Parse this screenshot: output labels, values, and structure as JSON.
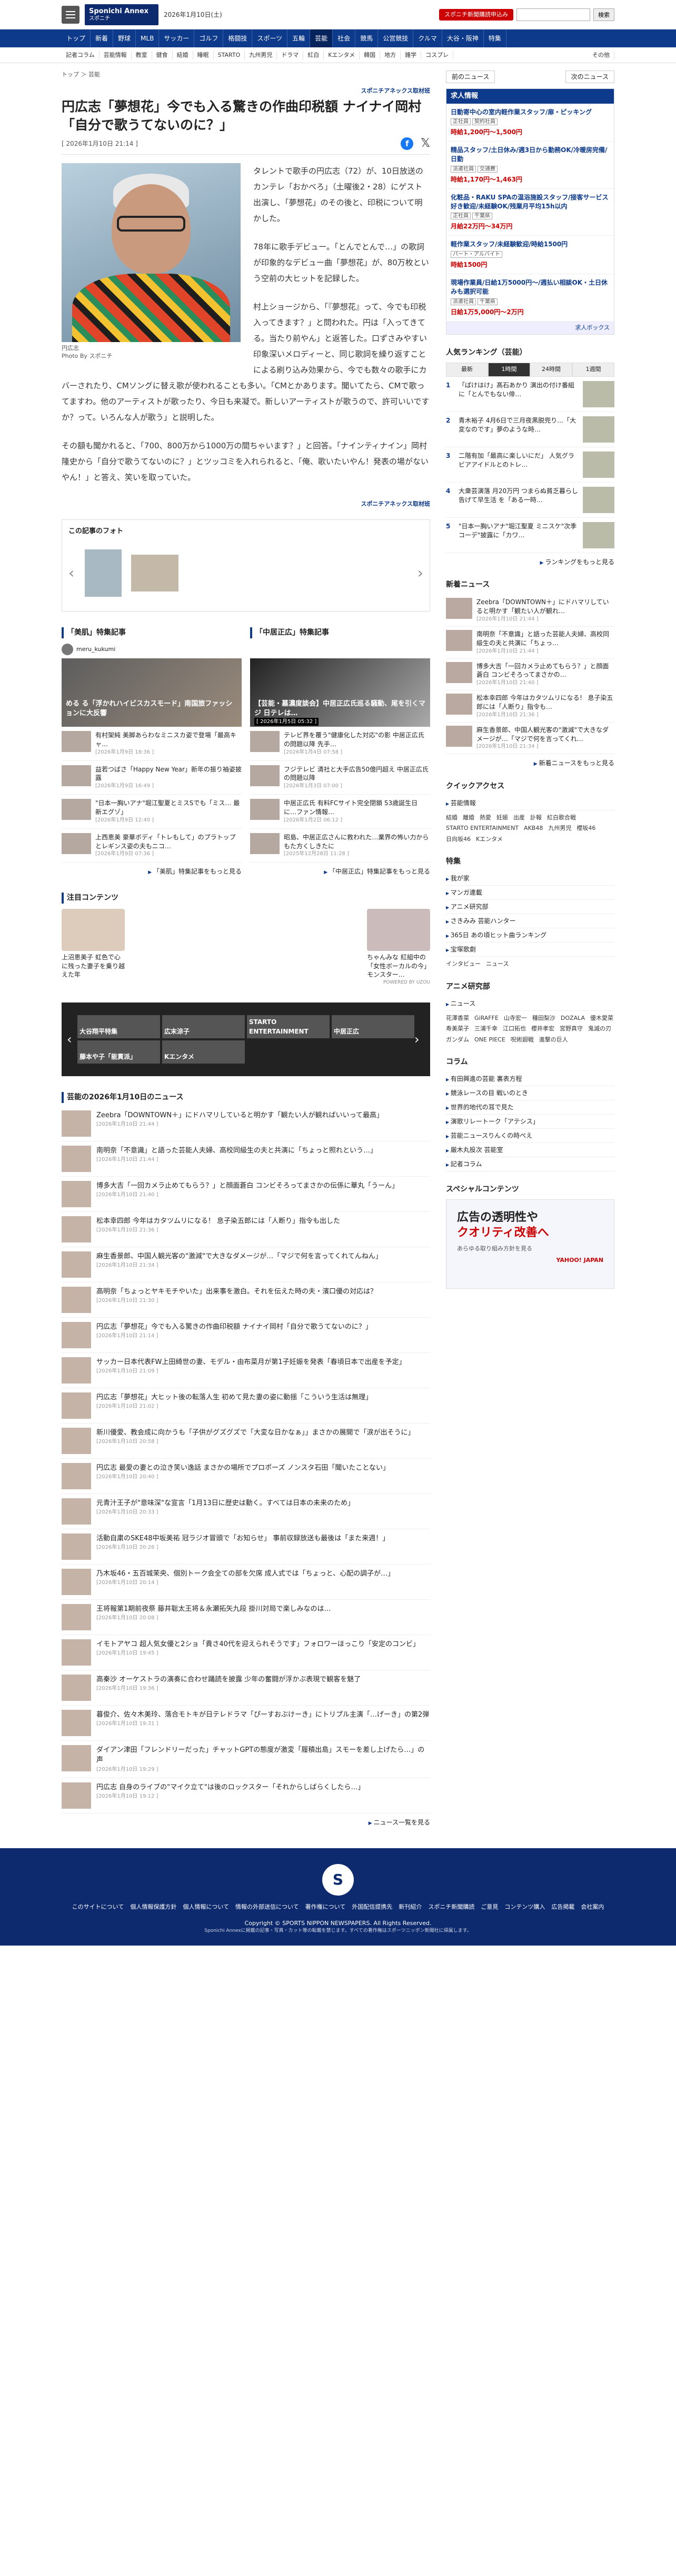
{
  "header": {
    "logo_title": "Sponichi Annex",
    "logo_sub": "スポニチ",
    "date": "2026年1月10日(土)",
    "promo": "スポニチ新聞購読申込み",
    "search_placeholder": "",
    "search_button": "検索"
  },
  "nav": [
    "トップ",
    "新着",
    "野球",
    "MLB",
    "サッカー",
    "ゴルフ",
    "格闘技",
    "スポーツ",
    "五輪",
    "芸能",
    "社会",
    "競馬",
    "公営競技",
    "クルマ",
    "大谷・阪神",
    "特集"
  ],
  "subnav": [
    "記者コラム",
    "芸能情報",
    "教室",
    "健食",
    "結婚",
    "睡眠",
    "STARTO",
    "九州男児",
    "ドラマ",
    "紅白",
    "Kエンタメ",
    "韓国",
    "地方",
    "雑学",
    "コスプレ",
    "その他"
  ],
  "breadcrumb": "トップ ＞ 芸能",
  "article": {
    "source": "スポニチアネックス取材班",
    "title": "円広志「夢想花」今でも入る驚きの作曲印税額 ナイナイ岡村「自分で歌うてないのに？」",
    "date": "[ 2026年1月10日 21:14 ]",
    "caption": "円広志",
    "credit": "Photo By スポニチ",
    "p1": "タレントで歌手の円広志（72）が、10日放送のカンテレ「おかべろ」（土曜後2・28）にゲスト出演し、「夢想花」のその後と、印税について明かした。",
    "p2": "78年に歌手デビュー。「とんでとんで…」の歌詞が印象的なデビュー曲「夢想花」が、80万枚という空前の大ヒットを記録した。",
    "p3": "村上ショージから、「『夢想花』って、今でも印税入ってきます？」と問われた。円は「入ってきてる。当たり前やん」と返答した。口ずさみやすい印象深いメロディーと、同じ歌詞を繰り返すことによる刷り込み効果から、今でも数々の歌手にカバーされたり、CMソングに替え歌が使われることも多い。「CMとかあります。聞いてたら、CMで歌ってますわ。他のアーティストが歌ったり、今日も来凝で。新しいアーティストが歌うので、許可いいですか？って。いろんな人が歌う」と説明した。",
    "p4": "その額も聞かれると、「700、800万から1000万の間ちゃいます？」と回答。「ナインティナイン」岡村隆史から「自分で歌うてないのに？」とツッコミを入れられると、「俺、歌いたいやん！発表の場がないやん！」と答え、笑いを取っていた。",
    "source2": "スポニチアネックス取材班"
  },
  "photos_box": {
    "title": "この記事のフォト"
  },
  "features": [
    {
      "title": "「美肌」特集記事",
      "user": "meru_kukumi",
      "hero": "める る「浮かれハイビスカスモード」南国旅ファッションに大反響",
      "hero_date": "",
      "items": [
        {
          "t": "有村架純 美脚あらわなミニスカ姿で登場「最高キャ…",
          "d": "[2026年1月9日 18:36 ]"
        },
        {
          "t": "益若つばさ「Happy New Year」新年の振り袖姿披露",
          "d": "[2026年1月9日 16:49 ]"
        },
        {
          "t": "\"日本一胸いアナ\"堀江聖夏とミスSでも「ミス… 最新エグゾ」",
          "d": "[2026年1月9日 12:40 ]"
        },
        {
          "t": "上西恵美 豪華ボディ「トレもして」のプラトップとレギンス姿の夫もニコ…",
          "d": "[2026年1月9日 07:36 ]"
        }
      ]
    },
    {
      "title": "「中居正広」特集記事",
      "user": "",
      "hero": "【芸能・墓濃度談会】中居正広氏巡る騒動、尾を引くマジ 日テレは…",
      "hero_date": "[ 2026年1月5日 05:32 ]",
      "items": [
        {
          "t": "テレビ界を覆う\"健康化した対応\"の影 中居正広氏の問題以降 先手…",
          "d": "[2026年1月4日 07:58 ]"
        },
        {
          "t": "フジテレビ 清社と大手広告50億円超え 中居正広氏の問題以降",
          "d": "[2026年1月3日 07:00 ]"
        },
        {
          "t": "中居正広氏 有料FCサイト完全閉鎖 53歳誕生日に…ファン情報…",
          "d": "[2026年1月2日 06:12 ]"
        },
        {
          "t": "昭島、中居正広さんに救われた…業界の怖い力からもた方くしきたに",
          "d": "[2025年12月28日 11:28 ]"
        }
      ]
    }
  ],
  "features_more": [
    "「美肌」特集記事をもっと見る",
    "「中居正広」特集記事をもっと見る"
  ],
  "attention": {
    "title": "注目コンテンツ",
    "items": [
      {
        "t": "上沼恵美子 虹色で心に残った妻子を乗り越えた年"
      },
      {
        "t": "ちゃんみな 紅組中の「女性ボーカルの今」モンスター…"
      }
    ],
    "brand": "POWERED BY UZOU"
  },
  "banners": [
    "大谷翔平特集",
    "広末涼子",
    "STARTO ENTERTAINMENT",
    "中居正広",
    "藤本や子「能貫派」",
    "Kエンタメ"
  ],
  "news": {
    "title": "芸能の2026年1月10日のニュース",
    "more": "ニュース一覧を見る",
    "items": [
      {
        "t": "Zeebra「DOWNTOWN＋」にドハマリしていると明かす「観たい人が観ればいいって最高」",
        "d": "[2026年1月10日 21:44 ]"
      },
      {
        "t": "南明奈「不意識」と語った芸能人夫婦、高校同級生の夫と共演に「ちょっと照れという…」",
        "d": "[2026年1月10日 21:44 ]"
      },
      {
        "t": "博多大吉「一回カメラ止めてもらう？」と顔面蒼白 コンビそろってまさかの伝係に華丸「うーん」",
        "d": "[2026年1月10日 21:40 ]"
      },
      {
        "t": "松本幸四郎 今年はカタツムリになる！ 息子染五郎には「人断り」指令も出した",
        "d": "[2026年1月10日 21:36 ]"
      },
      {
        "t": "麻生香景郎、中国人観光客の\"激減\"で大きなダメージが…「マジで何を言ってくれてんねん」",
        "d": "[2026年1月10日 21:34 ]"
      },
      {
        "t": "高明奈「ちょっとヤキモチやいた」出来事を激白。それを伝えた時の夫・濱口優の対応は？",
        "d": "[2026年1月10日 21:30 ]"
      },
      {
        "t": "円広志「夢想花」今でも入る驚きの作曲印税額 ナイナイ岡村「自分で歌うてないのに？」",
        "d": "[2026年1月10日 21:14 ]"
      },
      {
        "t": "サッカー日本代表FW上田綺世の妻、モデル・由布菜月が第1子妊娠を発表「春頃日本で出産を予定」",
        "d": "[2026年1月10日 21:09 ]"
      },
      {
        "t": "円広志「夢想花」大ヒット後の転落人生 初めて見た妻の姿に動揺「こういう生活は無理」",
        "d": "[2026年1月10日 21:02 ]"
      },
      {
        "t": "新川優愛、教会成に向かうも「子供がグズグズで「大変な日かなぁ」」まさかの展開で「涙が出そうに」",
        "d": "[2026年1月10日 20:58 ]"
      },
      {
        "t": "円広志 最愛の妻との泣き笑い逸話 まさかの場所でプロポーズ ノンスタ石田「聞いたことない」",
        "d": "[2026年1月10日 20:40 ]"
      },
      {
        "t": "元青汁王子が\"意味深\"な宣言「1月13日に歴史は動く。すべては日本の未来のため」",
        "d": "[2026年1月10日 20:33 ]"
      },
      {
        "t": "活動自粛のSKE48中坂美祐 冠ラジオ冒頭で「お知らせ」 事前収録放送も最後は「また来週！」",
        "d": "[2026年1月10日 20:26 ]"
      },
      {
        "t": "乃木坂46・五百城茉央、個別トーク会全ての部を欠席 成人式では「ちょっと、心配の調子が…」",
        "d": "[2026年1月10日 20:14 ]"
      },
      {
        "t": "王将報第1期前夜祭 藤井聡太王将＆永瀬拓矢九段 掛川対局で楽しみなのは…",
        "d": "[2026年1月10日 20:08 ]"
      },
      {
        "t": "イモトアヤコ 超人気女優と2ショ「貴さ40代を迎えられそうです」フォロワーほっこり「安定のコンビ」",
        "d": "[2026年1月10日 19:45 ]"
      },
      {
        "t": "高秦沙 オーケストラの演奏に合わせ踊読を披露 少年の奮闘が浮かぶ表現で観客を魅了",
        "d": "[2026年1月10日 19:36 ]"
      },
      {
        "t": "暮俊介、佐々木美玲、落合モトキが日テレドラマ「ぴーすおぶけーき」にトリプル主演「…げーき」の第2弾",
        "d": "[2026年1月10日 19:31 ]"
      },
      {
        "t": "ダイアン津田「フレンドリーだった」チャットGPTの態度が激変「履積出島」スモーを差し上げたら…」の声",
        "d": "[2026年1月10日 19:29 ]"
      },
      {
        "t": "円広志 自身のライブの\"マイク立て\"は後のロックスター「それからしばらくしたら…」",
        "d": "[2026年1月10日 19:12 ]"
      }
    ]
  },
  "right": {
    "prev": "前のニュース",
    "next": "次のニュース",
    "jobs": {
      "title": "求人情報",
      "footer": "求人ボックス",
      "items": [
        {
          "t": "日動寄中心の室内軽作業スタッフ/扉・ピッキング",
          "tags": [
            "正社員",
            "契約社員"
          ],
          "pay": "時給1,200円〜1,500円"
        },
        {
          "t": "精品スタッフ/土日休み/週3日から勤務OK/冷暖房完備/日勤",
          "tags": [
            "派遣社員",
            "交通費"
          ],
          "pay": "時給1,170円〜1,463円"
        },
        {
          "t": "化粧品・RAKU SPAの温浴施設スタッフ/接客サービス好き歓迎/未経験OK/残業月平均15h以内",
          "tags": [
            "正社員",
            "千葉県"
          ],
          "pay": "月給22万円〜34万円"
        },
        {
          "t": "軽作業スタッフ/未経験歓迎/時給1500円",
          "tags": [
            "パート・アルバイト"
          ],
          "pay": "時給1500円"
        },
        {
          "t": "現場作業員/日給1万5000円〜/週払い相談OK・土日休みも選択可能",
          "tags": [
            "派遣社員",
            "千葉県"
          ],
          "pay": "日給1万5,000円〜2万円"
        }
      ]
    },
    "ranking": {
      "title": "人気ランキング（芸能）",
      "tabs": [
        "最新",
        "1時間",
        "24時間",
        "1週間"
      ],
      "items": [
        {
          "n": "1",
          "t": "「ぱけはけ」髙石あかり 演出の付け番組に「とんでもない俳…"
        },
        {
          "n": "2",
          "t": "青木裕子 4月6日で三月夜黒脱兜り…「大変なのです」夢のような時…"
        },
        {
          "n": "3",
          "t": "二階有加「最高に楽しいにだ」 人気グラビアアイドルとのトレ…"
        },
        {
          "n": "4",
          "t": "大衆芸演落 月20万円 つまらぬ貧乏暮らし告げて早生活 を「ある一時…"
        },
        {
          "n": "5",
          "t": "\"日本一胸いアナ\"堀江聖夏 ミニスケ\"次季コーデ\"披露に「カワ…"
        }
      ],
      "more": "ランキングをもっと見る"
    },
    "latest": {
      "title": "新着ニュース",
      "more": "新着ニュースをもっと見る",
      "items": [
        {
          "t": "Zeebra「DOWNTOWN＋」にドハマリしていると明かす「観たい人が観れ…",
          "d": "[2026年1月10日 21:44 ]"
        },
        {
          "t": "南明奈「不意識」と語った芸能人夫婦、高校同級生の夫と共演に「ちょっ…",
          "d": "[2026年1月10日 21:44 ]"
        },
        {
          "t": "博多大吉「一回カメラ止めてもらう？」と顔面蒼白 コンビそろってまさかの…",
          "d": "[2026年1月10日 21:40 ]"
        },
        {
          "t": "松本幸四郎 今年はカタツムリになる！ 息子染五郎には「人断り」指令も…",
          "d": "[2026年1月10日 21:36 ]"
        },
        {
          "t": "麻生香景郎、中国人観光客の\"激減\"で大きなダメージが…「マジで何を言ってくれ…",
          "d": "[2026年1月10日 21:34 ]"
        }
      ]
    },
    "quick": {
      "title": "クイックアクセス",
      "head": "芸能情報",
      "tags": [
        "結婚",
        "離婚",
        "熱愛",
        "妊娠",
        "出産",
        "訃報",
        "紅白歌合戦",
        "STARTO ENTERTAINMENT",
        "AKB48",
        "九州男児",
        "櫻坂46",
        "日向坂46",
        "Kエンタメ"
      ]
    },
    "special": {
      "title": "特集",
      "items": [
        "我が家",
        "マンガ連載",
        "アニメ研究部",
        "さきみみ 芸能ハンター",
        "365日 あの頃ヒット曲ランキング",
        "宝塚歌劇"
      ],
      "foot": [
        "インタビュー",
        "ニュース"
      ]
    },
    "anime": {
      "title": "アニメ研究部",
      "head": "ニュース",
      "tags": [
        "花澤香菜",
        "GiRAFFE",
        "山寺宏一",
        "種田梨沙",
        "DOZALA",
        "優木愛菜",
        "寿美菜子",
        "三浦千幸",
        "江口拓也",
        "櫻井孝宏",
        "宮野真守",
        "鬼滅の刃",
        "ガンダム",
        "ONE PIECE",
        "呪術廻戦",
        "進撃の巨人"
      ]
    },
    "column": {
      "title": "コラム",
      "items": [
        "有田興進の芸能 裏表方程",
        "競泳レースの目 戦いのとき",
        "世界的地代の耳で見た",
        "演歌リレートーク「アテシス」",
        "芸能ニュースりんくの時ぺえ",
        "厳木丸投次 芸能室",
        "記者コラム"
      ]
    },
    "sp": {
      "title": "スペシャルコンテンツ",
      "ad1": "広告の透明性や",
      "ad2": "クオリティ改善へ",
      "ad_sub": "あらゆる取り組み方針を見る",
      "brand": "YAHOO! JAPAN"
    }
  },
  "footer": {
    "logo": "S",
    "links": [
      "このサイトについて",
      "個人情報保護方針",
      "個人情報について",
      "情報の外部送信について",
      "著作権について",
      "外国配信提携先",
      "新刊紹介",
      "スポニチ新聞購読",
      "ご意見",
      "コンテンツ購入",
      "広告掲載",
      "会社案内"
    ],
    "copy": "Copyright © SPORTS NIPPON NEWSPAPERS. All Rights Reserved.",
    "sub": "Sponichi Annexに掲載の記事・写真・カット等の転載を禁じます。すべての著作権はスポーツニッポン新聞社に帰属します。"
  }
}
